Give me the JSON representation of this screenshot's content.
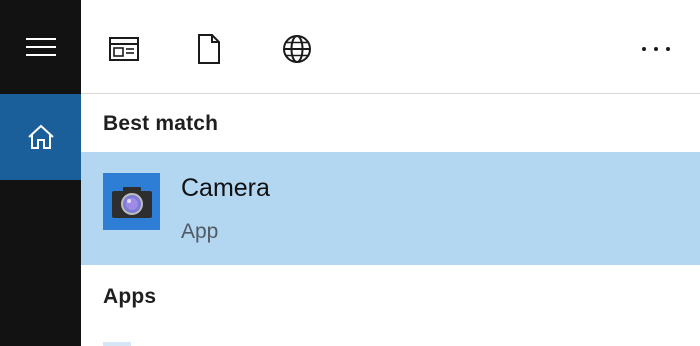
{
  "sidebar": {
    "menu_icon": "hamburger-icon",
    "home_icon": "home-icon",
    "active_color": "#1a5e9a"
  },
  "toolbar": {
    "icons": [
      "apps-filter-icon",
      "documents-filter-icon",
      "web-filter-icon",
      "more-icon"
    ]
  },
  "best_match": {
    "heading": "Best match",
    "result": {
      "name": "Camera",
      "type": "App",
      "icon": "camera-icon",
      "highlight_color": "#b3d6f1",
      "tile_color": "#2f7ed6"
    }
  },
  "apps": {
    "heading": "Apps"
  }
}
